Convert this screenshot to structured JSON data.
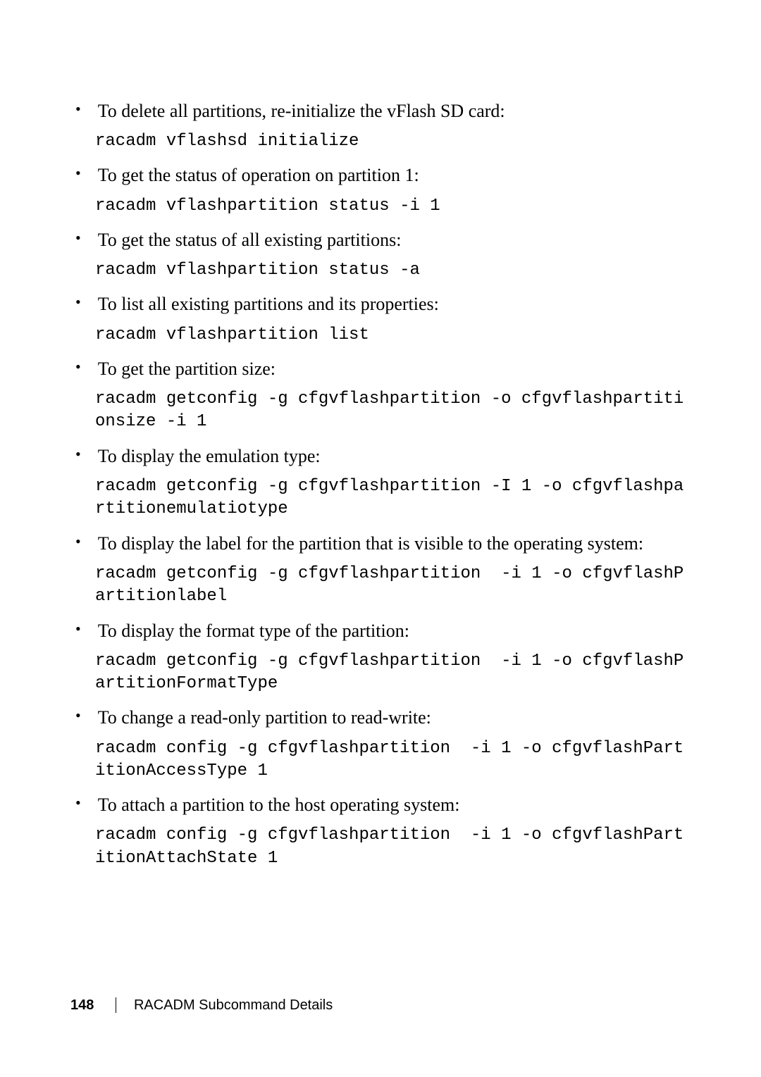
{
  "items": [
    {
      "desc": "To delete all partitions, re-initialize the vFlash SD card:",
      "code": "racadm vflashsd initialize"
    },
    {
      "desc": "To get the status of operation on partition 1:",
      "code": "racadm vflashpartition status -i 1"
    },
    {
      "desc": "To get the status of all existing partitions:",
      "code": "racadm vflashpartition status -a"
    },
    {
      "desc": "To list all existing partitions and its properties:",
      "code": "racadm vflashpartition list"
    },
    {
      "desc": "To get the partition size:",
      "code": "racadm getconfig -g cfgvflashpartition -o cfgvflashpartitionsize -i 1"
    },
    {
      "desc": "To display the emulation type:",
      "code": "racadm getconfig -g cfgvflashpartition -I 1 -o cfgvflashpartitionemulatiotype"
    },
    {
      "desc": "To display the label for the partition that is visible to the operating system:",
      "code": "racadm getconfig -g cfgvflashpartition  -i 1 -o cfgvflashPartitionlabel"
    },
    {
      "desc": "To display the format type of the partition:",
      "code": "racadm getconfig -g cfgvflashpartition  -i 1 -o cfgvflashPartitionFormatType"
    },
    {
      "desc": "To change a read-only partition to read-write:",
      "code": "racadm config -g cfgvflashpartition  -i 1 -o cfgvflashPartitionAccessType 1"
    },
    {
      "desc": "To attach a partition to the host operating system:",
      "code": "racadm config -g cfgvflashpartition  -i 1 -o cfgvflashPartitionAttachState 1"
    }
  ],
  "footer": {
    "page": "148",
    "section": "RACADM Subcommand Details"
  },
  "bullet_char": "•"
}
